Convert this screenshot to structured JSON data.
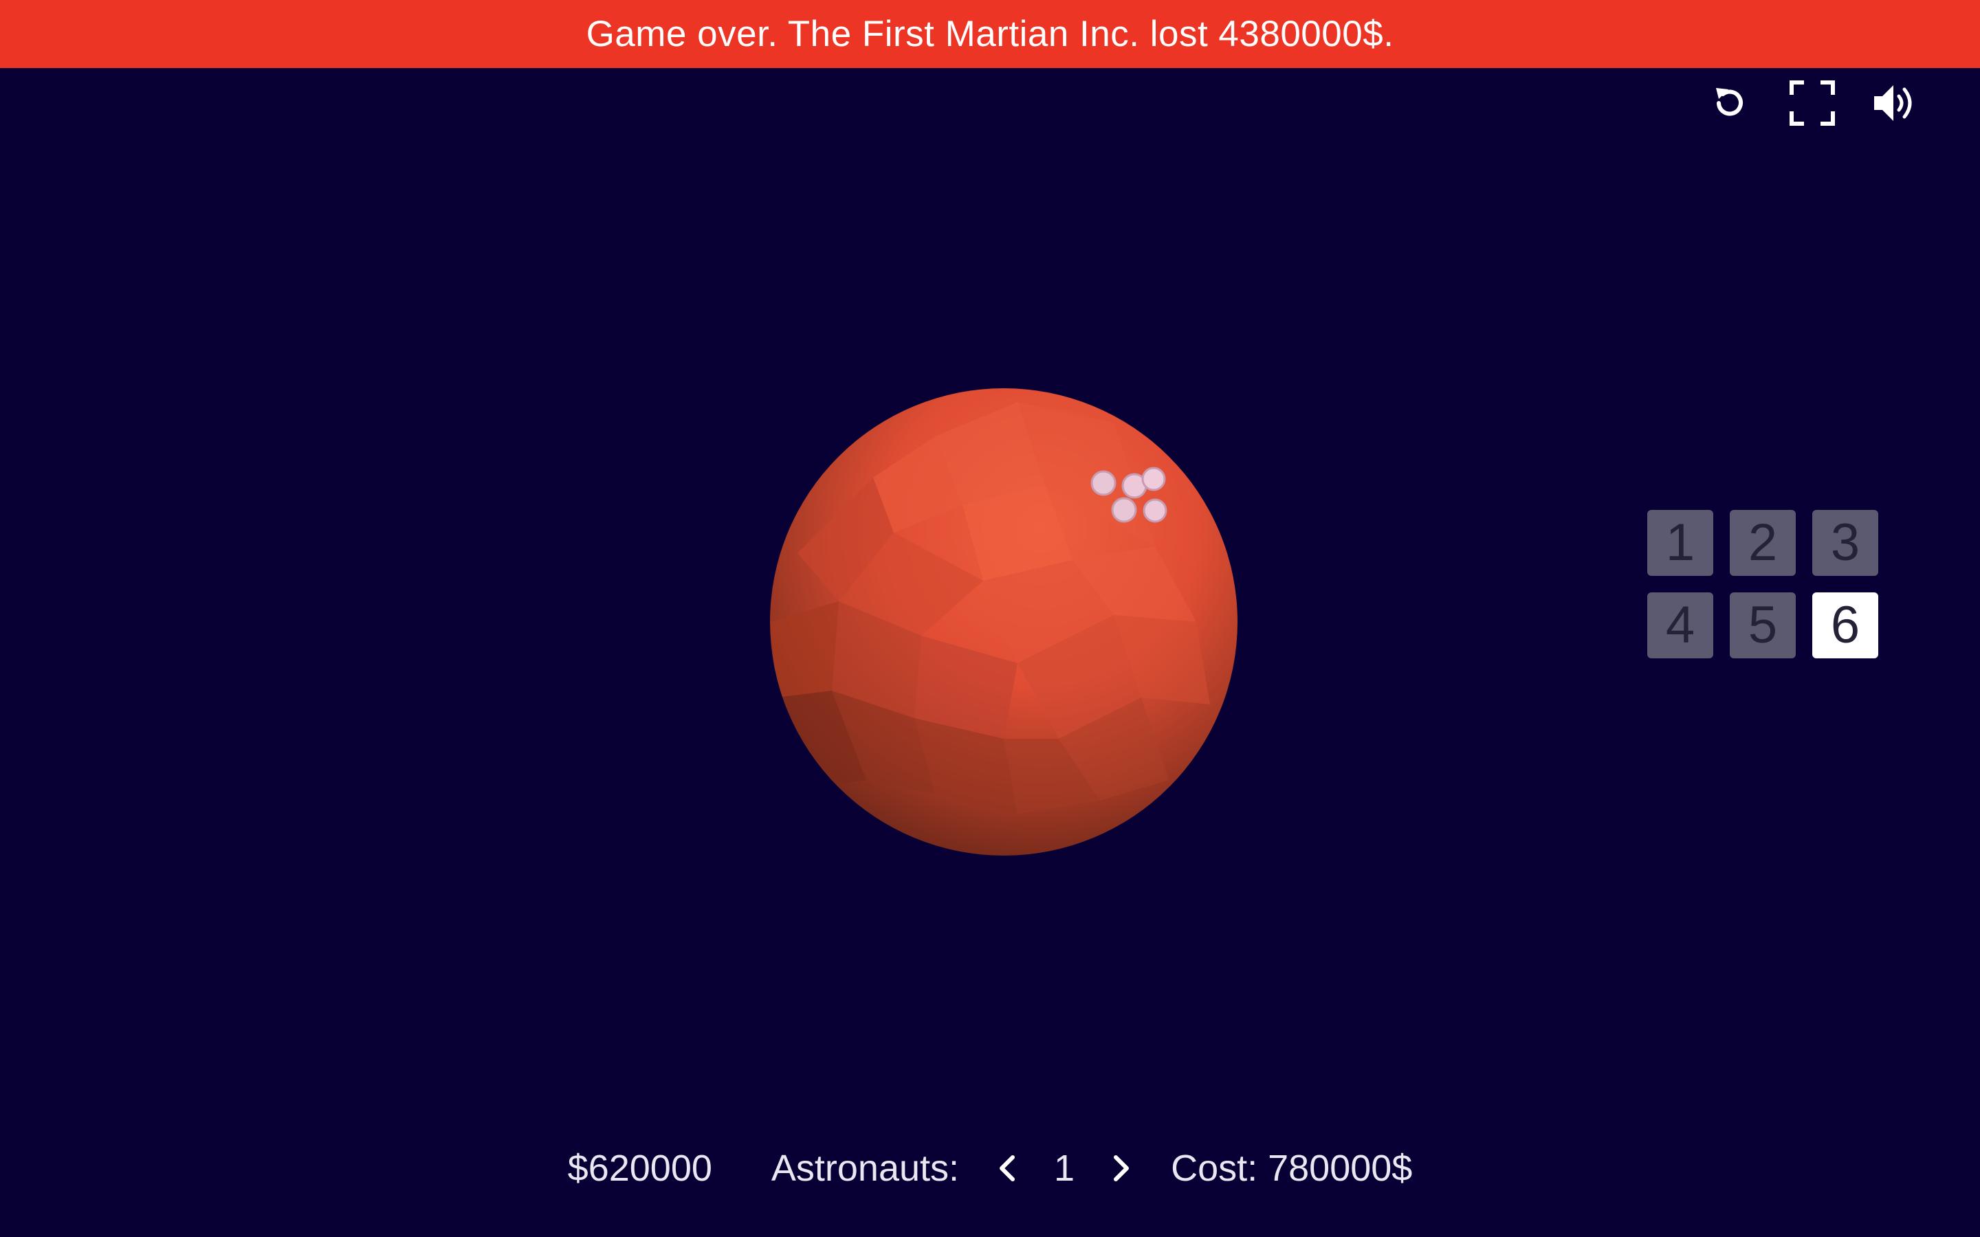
{
  "banner": {
    "message": "Game over. The First Martian Inc. lost 4380000$.",
    "color": "#ec3524"
  },
  "controls": {
    "restart_icon": "restart-icon",
    "fullscreen_icon": "fullscreen-icon",
    "sound_icon": "speaker-icon"
  },
  "scene": {
    "background": "#080034",
    "planet_color": "#e8543a",
    "colony_pods": 5
  },
  "levels": {
    "items": [
      "1",
      "2",
      "3",
      "4",
      "5",
      "6"
    ],
    "selected": "6"
  },
  "footer": {
    "money": "$620000",
    "astronauts_label": "Astronauts:",
    "astronauts_count": "1",
    "cost": "Cost: 780000$"
  }
}
